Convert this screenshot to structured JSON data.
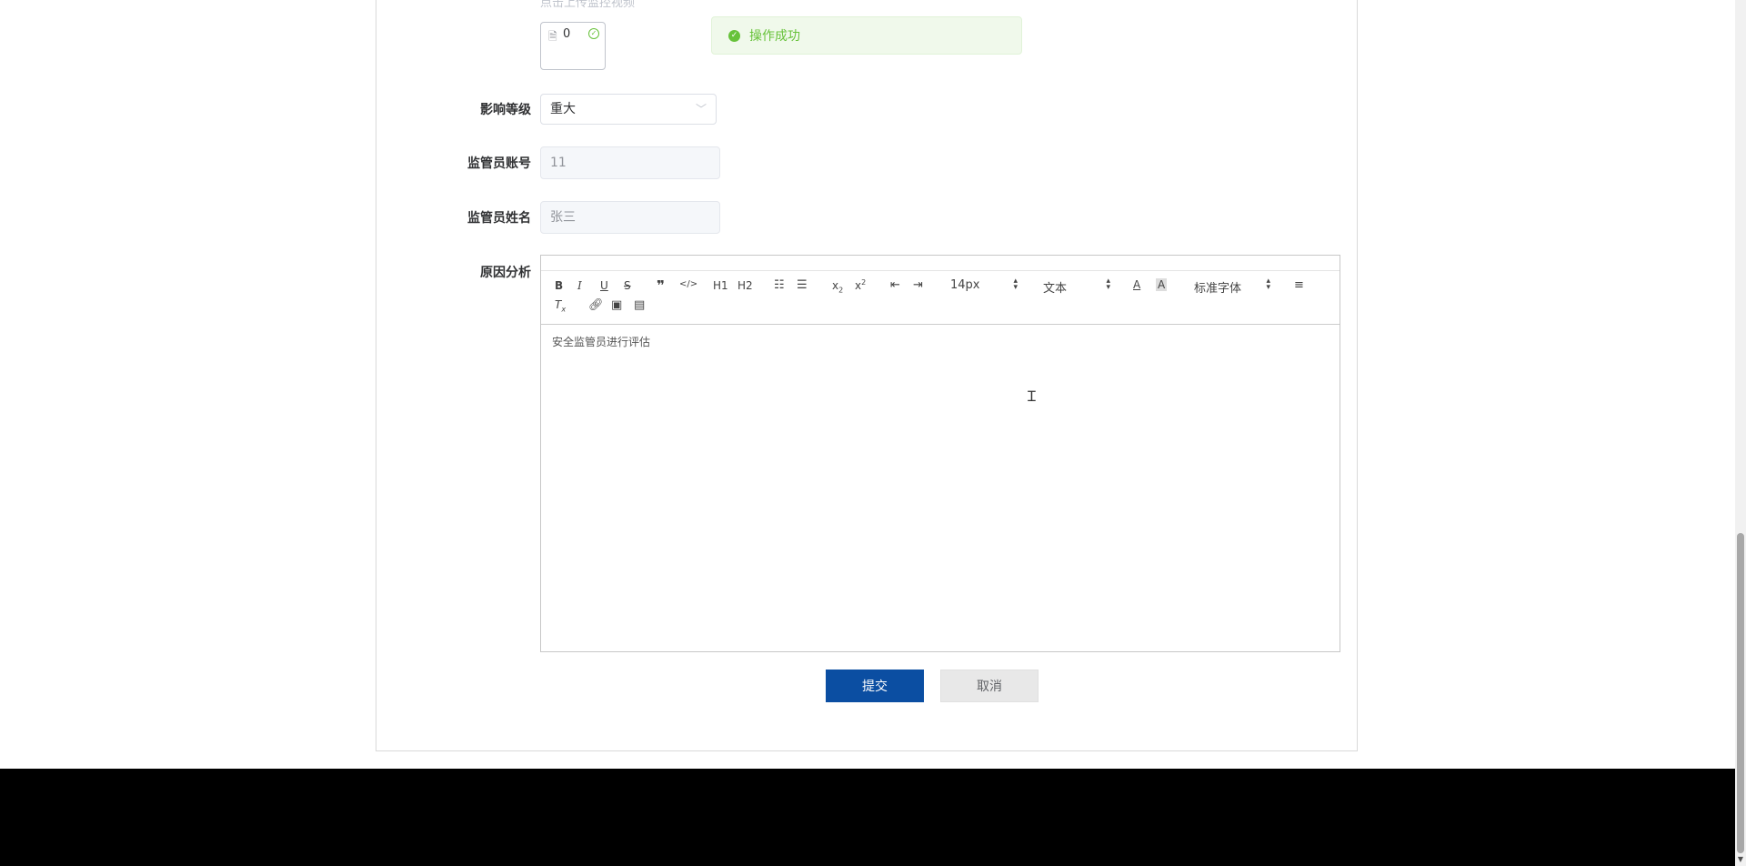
{
  "toast": {
    "message": "操作成功"
  },
  "upload": {
    "hint": "点击上传监控视频",
    "file_name": "0"
  },
  "form": {
    "impact_level": {
      "label": "影响等级",
      "value": "重大"
    },
    "supervisor_account": {
      "label": "监管员账号",
      "value": "11"
    },
    "supervisor_name": {
      "label": "监管员姓名",
      "value": "张三"
    },
    "cause_analysis": {
      "label": "原因分析",
      "content": "安全监管员进行评估"
    }
  },
  "editor_toolbar": {
    "font_size": "14px",
    "block_format": "文本",
    "font_family": "标准字体",
    "h1": "H1",
    "h2": "H2"
  },
  "buttons": {
    "submit": "提交",
    "cancel": "取消"
  },
  "colors": {
    "primary": "#0b4ea2",
    "success": "#67c23a",
    "toast_bg": "#f0f9eb"
  }
}
